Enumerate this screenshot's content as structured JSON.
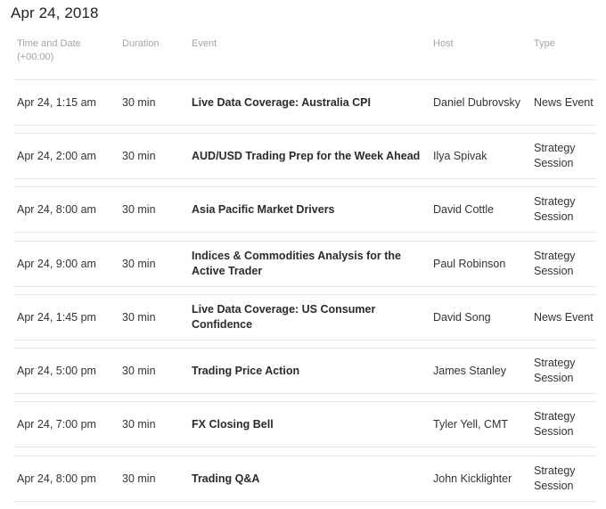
{
  "date_heading": "Apr 24, 2018",
  "columns": {
    "time_line1": "Time and Date",
    "time_line2": "(+00:00)",
    "duration": "Duration",
    "event": "Event",
    "host": "Host",
    "type": "Type"
  },
  "rows": [
    {
      "time": "Apr 24, 1:15 am",
      "duration": "30 min",
      "event": "Live Data Coverage: Australia CPI",
      "host": "Daniel Dubrovsky",
      "type": "News Event"
    },
    {
      "time": "Apr 24, 2:00 am",
      "duration": "30 min",
      "event": "AUD/USD Trading Prep for the Week Ahead",
      "host": "Ilya Spivak",
      "type": "Strategy Session"
    },
    {
      "time": "Apr 24, 8:00 am",
      "duration": "30 min",
      "event": "Asia Pacific Market Drivers",
      "host": "David Cottle",
      "type": "Strategy Session"
    },
    {
      "time": "Apr 24, 9:00 am",
      "duration": "30 min",
      "event": "Indices & Commodities Analysis for the Active Trader",
      "host": "Paul Robinson",
      "type": "Strategy Session"
    },
    {
      "time": "Apr 24, 1:45 pm",
      "duration": "30 min",
      "event": "Live Data Coverage: US Consumer Confidence",
      "host": "David Song",
      "type": "News Event"
    },
    {
      "time": "Apr 24, 5:00 pm",
      "duration": "30 min",
      "event": "Trading Price Action",
      "host": "James Stanley",
      "type": "Strategy Session"
    },
    {
      "time": "Apr 24, 7:00 pm",
      "duration": "30 min",
      "event": "FX Closing Bell",
      "host": "Tyler Yell, CMT",
      "type": "Strategy Session"
    },
    {
      "time": "Apr 24, 8:00 pm",
      "duration": "30 min",
      "event": "Trading Q&A",
      "host": "John Kicklighter",
      "type": "Strategy Session"
    }
  ]
}
